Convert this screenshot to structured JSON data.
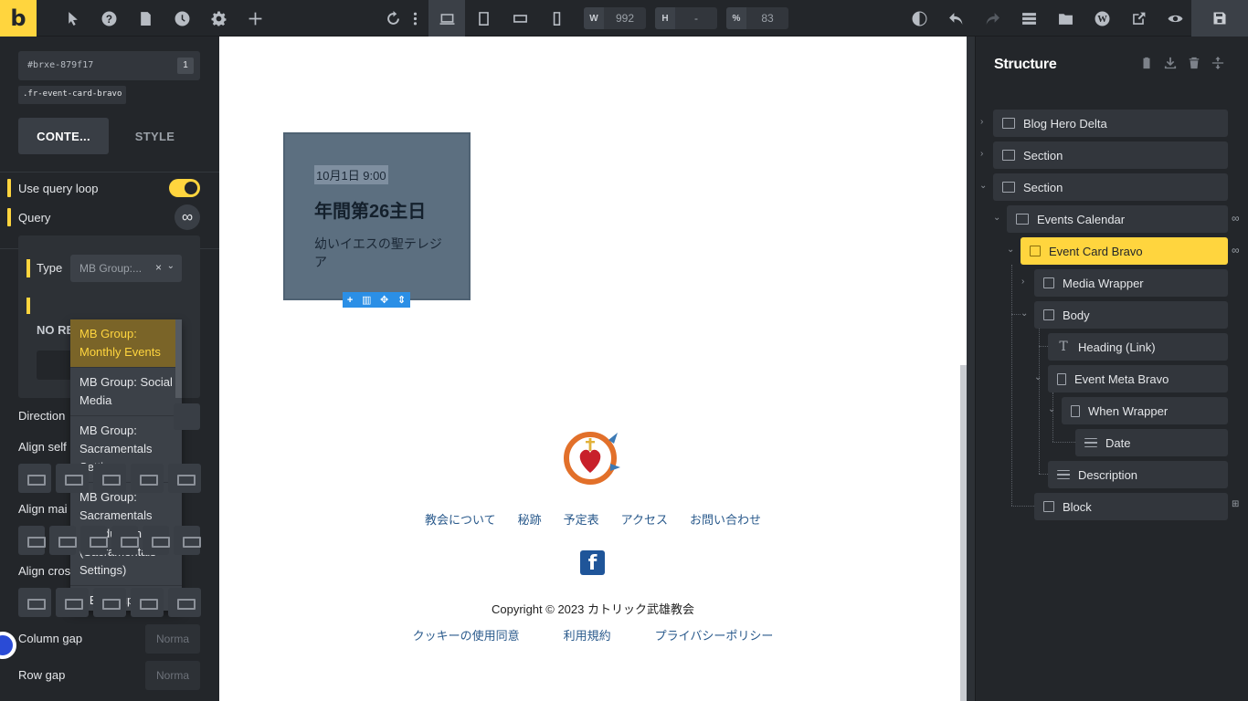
{
  "app": {
    "logo": "b"
  },
  "toolbar": {
    "icons": [
      "pointer-icon",
      "help-icon",
      "pages-icon",
      "history-icon",
      "settings-icon",
      "add-icon"
    ],
    "right_icons": [
      "undo-icon",
      "more-icon",
      "desktop-icon",
      "tablet-icon",
      "landscape-icon",
      "mobile-icon"
    ],
    "width_label": "W",
    "width_value": "992",
    "height_label": "H",
    "height_value": "-",
    "zoom_label": "%",
    "zoom_value": "83",
    "actions": [
      "contrast-icon",
      "undo-icon",
      "redo-icon",
      "stack-icon",
      "folder-icon",
      "wordpress-icon",
      "external-link-icon",
      "preview-icon",
      "save-icon"
    ]
  },
  "left_panel": {
    "element_id": "#brxe-879f17",
    "element_count": "1",
    "class_name": ".fr-event-card-bravo",
    "tabs": {
      "content": "CONTE...",
      "style": "STYLE"
    },
    "use_query_loop": "Use query loop",
    "query": "Query",
    "query_icon": "∞",
    "query_popup": {
      "type_label": "Type",
      "type_value": "MB Group:...",
      "clear": "×",
      "no_results": "NO RE"
    },
    "dropdown_options": [
      "MB Group: Monthly Events",
      "MB Group: Social Media",
      "MB Group: Sacramentals Settings",
      "MB Group: Sacramentals Introduction (Sacramentals Settings)",
      "MB Group:"
    ],
    "direction": "Direction",
    "align_self": "Align self",
    "align_main": "Align mai",
    "align_cross": "Align cros",
    "column_gap": "Column gap",
    "column_gap_placeholder": "Norma",
    "row_gap": "Row gap",
    "row_gap_placeholder": "Norma"
  },
  "canvas": {
    "card": {
      "date": "10月1日 9:00",
      "title": "年間第26主日",
      "description": "幼いイエスの聖テレジア"
    },
    "card_tools": [
      "+",
      "▥",
      "✥",
      "⇕"
    ],
    "footer_nav": [
      "教会について",
      "秘跡",
      "予定表",
      "アクセス",
      "お問い合わせ"
    ],
    "facebook": "f",
    "copyright": "Copyright © 2023 カトリック武雄教会",
    "legal": [
      "クッキーの使用同意",
      "利用規約",
      "プライバシーポリシー"
    ]
  },
  "structure": {
    "title": "Structure",
    "nodes": [
      {
        "label": "Blog Hero Delta"
      },
      {
        "label": "Section"
      },
      {
        "label": "Section"
      },
      {
        "label": "Events Calendar"
      },
      {
        "label": "Event Card Bravo"
      },
      {
        "label": "Media Wrapper"
      },
      {
        "label": "Body"
      },
      {
        "label": "Heading (Link)"
      },
      {
        "label": "Event Meta Bravo"
      },
      {
        "label": "When Wrapper"
      },
      {
        "label": "Date"
      },
      {
        "label": "Description"
      },
      {
        "label": "Block"
      }
    ]
  }
}
